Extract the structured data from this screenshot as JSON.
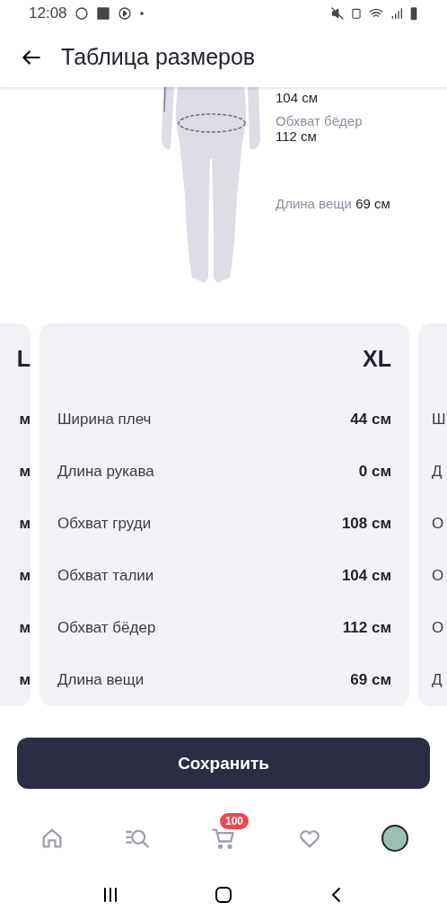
{
  "status_bar": {
    "time": "12:08"
  },
  "header": {
    "title": "Таблица размеров"
  },
  "figure_labels": [
    {
      "kind": "value_only",
      "value": "104 см"
    },
    {
      "kind": "stacked",
      "label": "Обхват бёдер",
      "value": "112 см"
    },
    {
      "kind": "inline",
      "label": "Длина вещи",
      "value": "69 см"
    }
  ],
  "size_cards": [
    {
      "kind": "peek_left",
      "size": "L",
      "rows": [
        {
          "value": "м"
        },
        {
          "value": "м"
        },
        {
          "value": "м"
        },
        {
          "value": "м"
        },
        {
          "value": "м"
        },
        {
          "value": "м"
        }
      ]
    },
    {
      "kind": "full",
      "size": "XL",
      "rows": [
        {
          "label": "Ширина плеч",
          "value": "44 см"
        },
        {
          "label": "Длина рукава",
          "value": "0 см"
        },
        {
          "label": "Обхват груди",
          "value": "108 см"
        },
        {
          "label": "Обхват талии",
          "value": "104 см"
        },
        {
          "label": "Обхват бёдер",
          "value": "112 см"
        },
        {
          "label": "Длина вещи",
          "value": "69 см"
        }
      ]
    },
    {
      "kind": "peek_right",
      "rows": [
        {
          "label": "Ш"
        },
        {
          "label": "Д"
        },
        {
          "label": "О"
        },
        {
          "label": "О"
        },
        {
          "label": "О"
        },
        {
          "label": "Д"
        }
      ]
    }
  ],
  "save_button": {
    "label": "Сохранить"
  },
  "bottom_nav": {
    "cart_badge": "100"
  }
}
